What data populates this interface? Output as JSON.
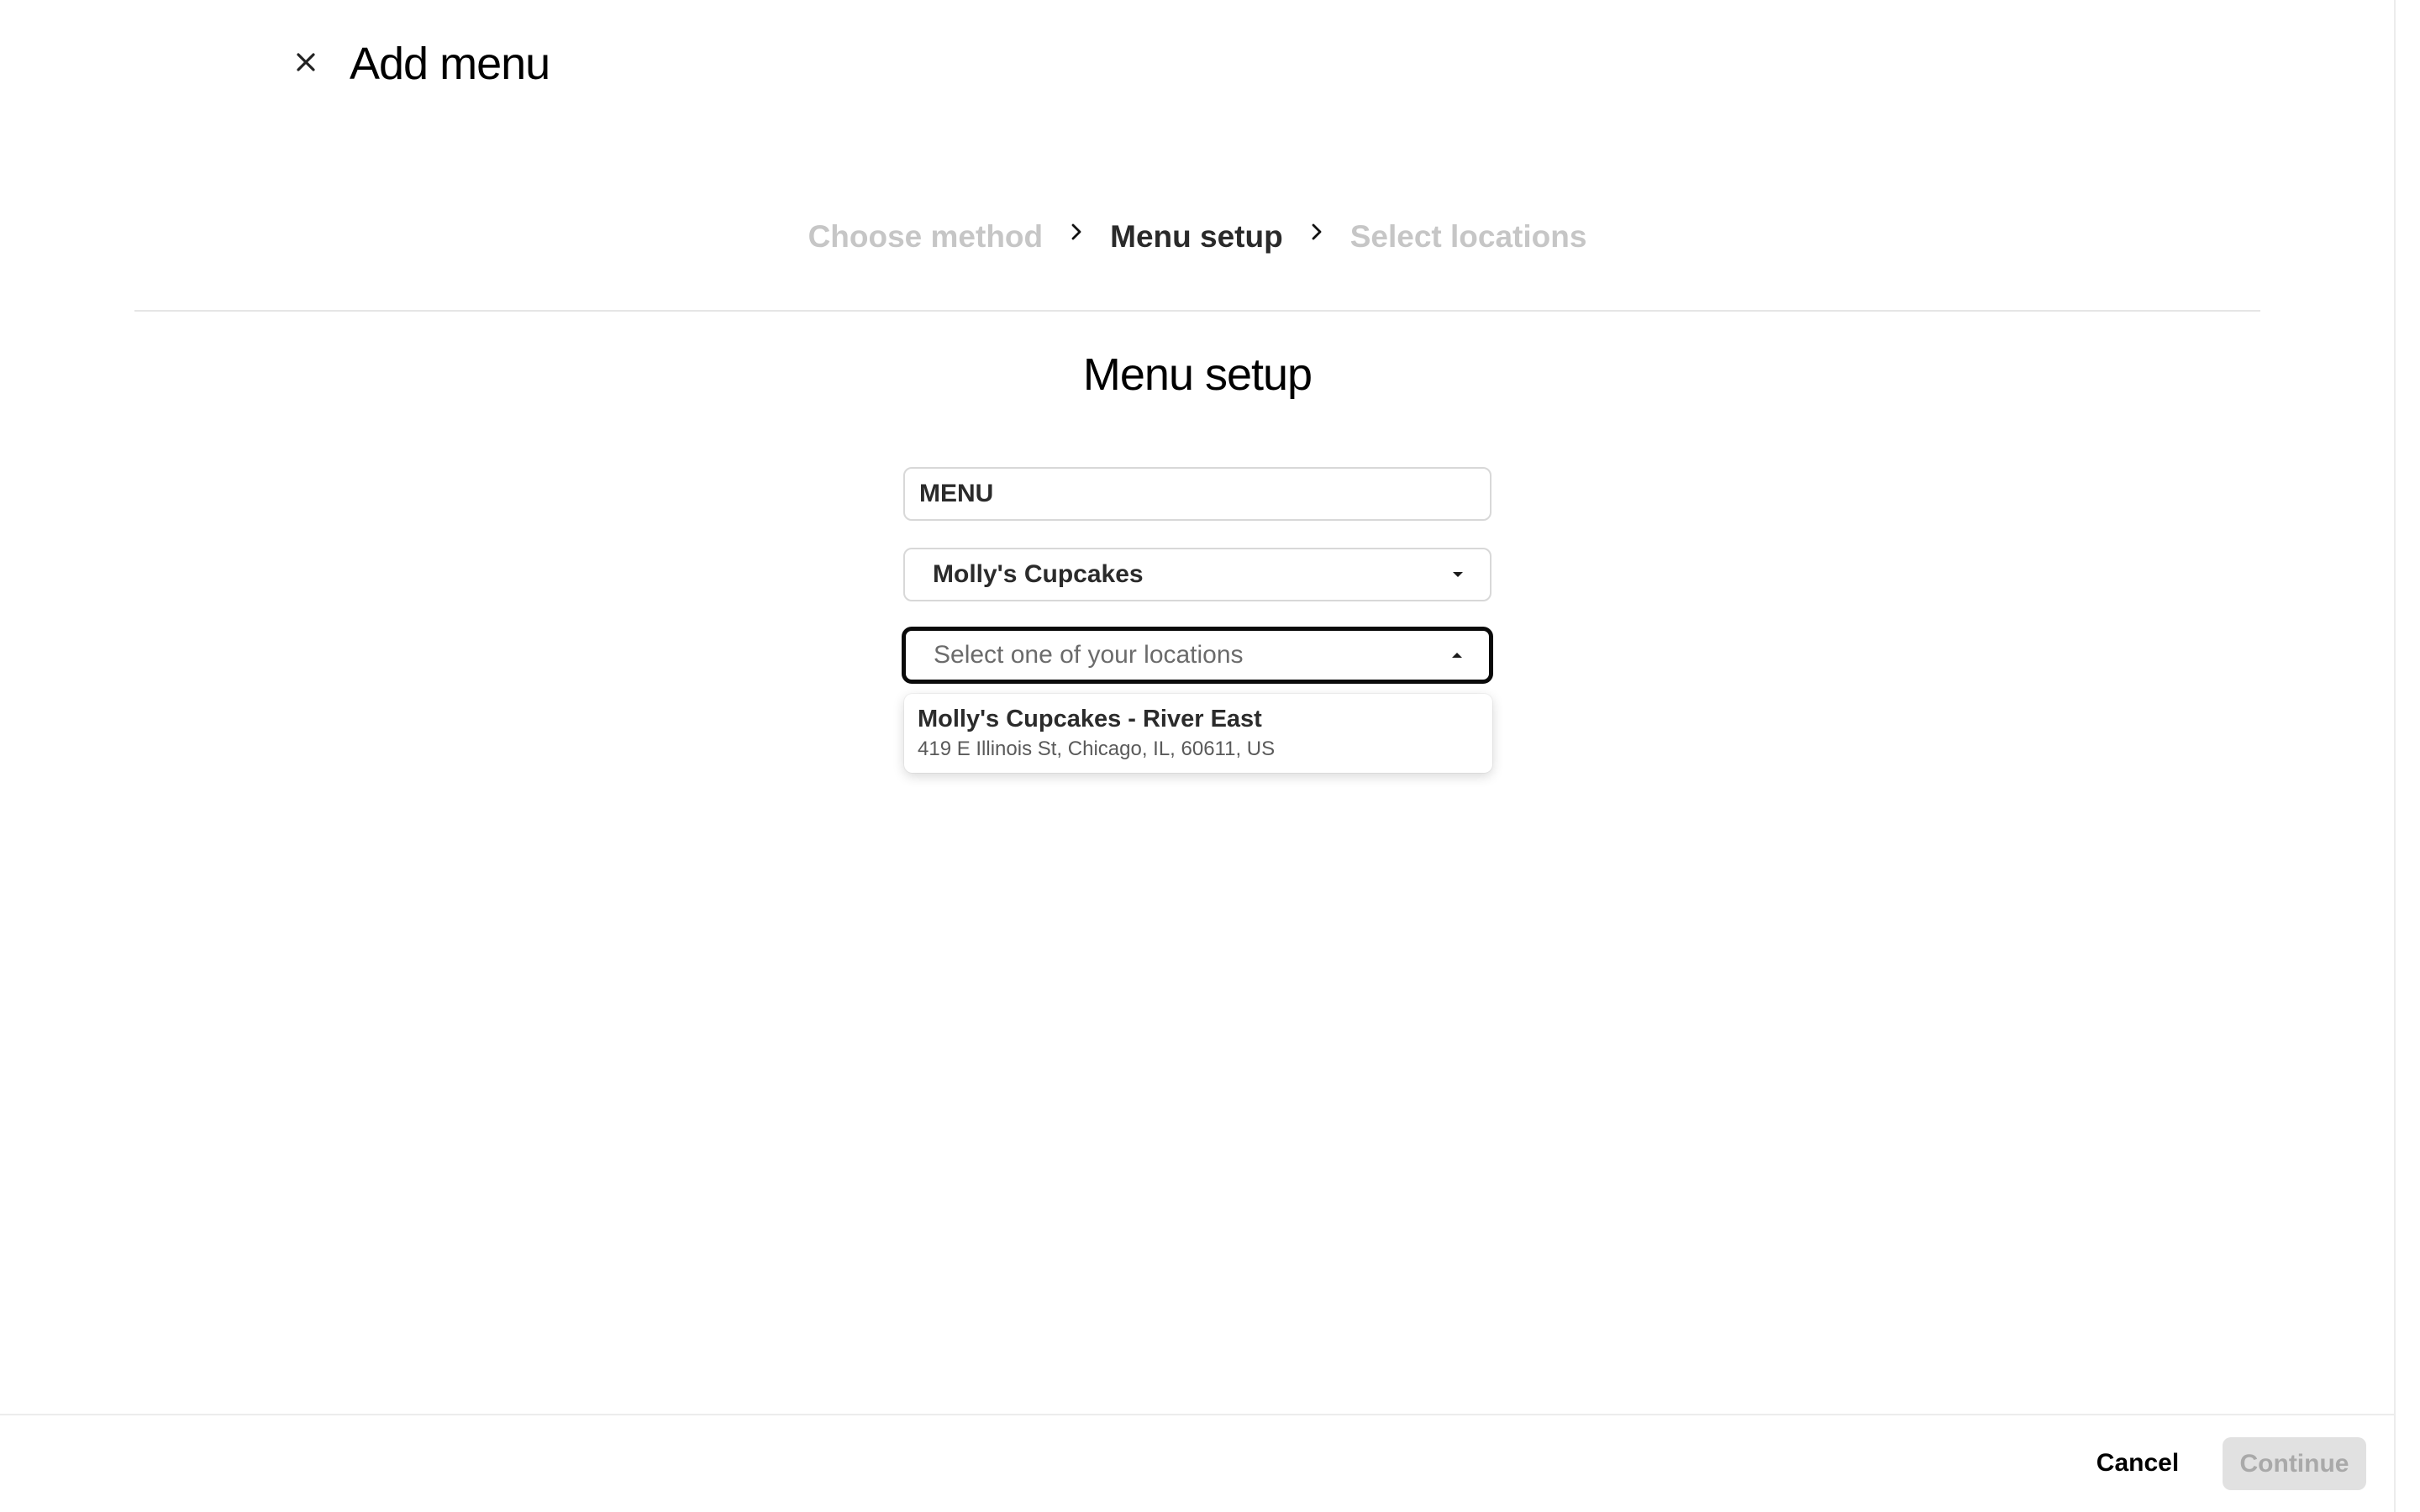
{
  "header": {
    "title": "Add menu",
    "close_icon": "close-icon"
  },
  "stepper": {
    "steps": [
      {
        "label": "Choose method",
        "state": "inactive"
      },
      {
        "label": "Menu setup",
        "state": "active"
      },
      {
        "label": "Select locations",
        "state": "inactive"
      }
    ],
    "separator_icon": "chevron-right-icon"
  },
  "main": {
    "section_title": "Menu setup",
    "menu_name": {
      "value": "MENU"
    },
    "brand_select": {
      "value": "Molly's Cupcakes",
      "icon": "caret-down-icon"
    },
    "location_select": {
      "placeholder": "Select one of your locations",
      "icon": "caret-up-icon",
      "expanded": true,
      "options": [
        {
          "name": "Molly's Cupcakes - River East",
          "address": "419 E Illinois St, Chicago, IL, 60611, US"
        }
      ]
    }
  },
  "footer": {
    "cancel_label": "Cancel",
    "continue_label": "Continue",
    "continue_enabled": false
  },
  "colors": {
    "text_primary": "#000000",
    "inactive_step": "#c6c6c6",
    "focus_border": "#0a0a0a",
    "disabled_button_bg": "#e1e1e1",
    "disabled_button_text": "#a9a9a9"
  }
}
